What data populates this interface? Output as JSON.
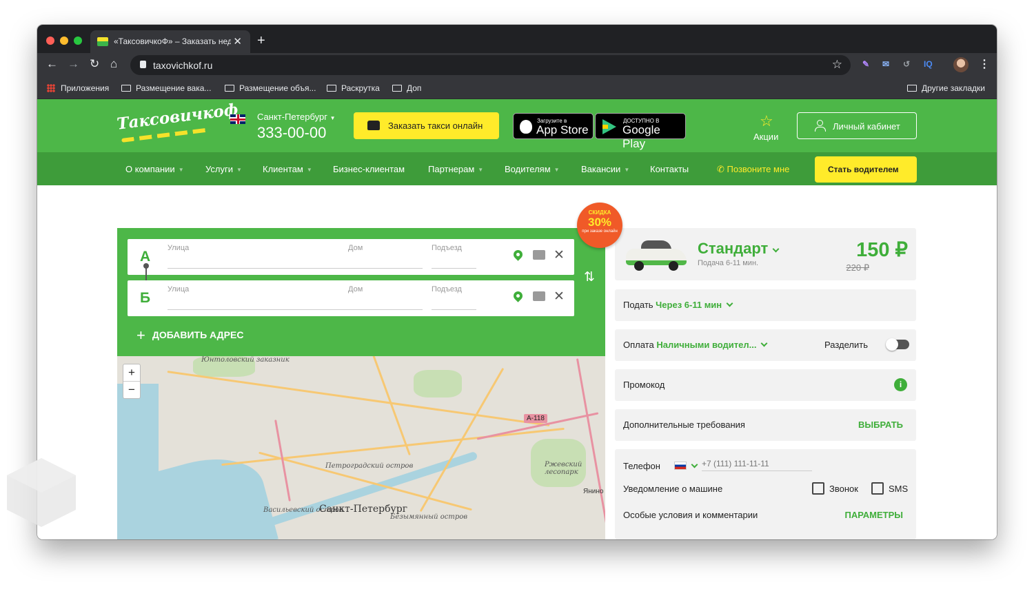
{
  "browser": {
    "tab_title": "«ТаксовичкоФ» – Заказать нед",
    "url": "taxovichkof.ru",
    "bookmarks": [
      "Приложения",
      "Размещение вака...",
      "Размещение объя...",
      "Раскрутка",
      "Доп"
    ],
    "other_bookmarks": "Другие закладки",
    "ext_iq": "IQ"
  },
  "header": {
    "logo_text": "Таксовичкоф",
    "city": "Санкт-Петербург",
    "phone": "333-00-00",
    "order_button": "Заказать такси онлайн",
    "app_store_small": "Загрузите в",
    "app_store_big": "App Store",
    "google_play_small": "ДОСТУПНО В",
    "google_play_big": "Google Play",
    "promos": "Акции",
    "cabinet": "Личный кабинет"
  },
  "nav": {
    "items": [
      "О компании",
      "Услуги",
      "Клиентам",
      "Бизнес-клиентам",
      "Партнерам",
      "Водителям",
      "Вакансии",
      "Контакты"
    ],
    "call_me": "Позвоните мне",
    "become_driver": "Стать водителем"
  },
  "discount": {
    "top": "СКИДКА",
    "value": "30%",
    "bottom": "при заказе онлайн"
  },
  "order_form": {
    "point_a": "А",
    "point_b": "Б",
    "street_label": "Улица",
    "house_label": "Дом",
    "entrance_label": "Подъезд",
    "add_address": "ДОБАВИТЬ АДРЕС"
  },
  "map": {
    "labels": [
      "Юнтоловский заказник",
      "Петроградский остров",
      "Васильевский остров",
      "Безымянный остров",
      "Ржевский лесопарк"
    ],
    "city_label": "Санкт-Петербург",
    "road_shield": "А-118",
    "janino": "Янино"
  },
  "tariff": {
    "name": "Стандарт",
    "sub": "Подача 6-11 мин.",
    "price": "150 ₽",
    "old_price": "220 ₽"
  },
  "options": {
    "pickup_label": "Подать",
    "pickup_value": "Через 6-11 мин",
    "payment_label": "Оплата",
    "payment_value": "Наличными водител...",
    "split_label": "Разделить",
    "promo_label": "Промокод",
    "extra_label": "Дополнительные требования",
    "extra_action": "ВЫБРАТЬ",
    "phone_label": "Телефон",
    "phone_placeholder": "+7 (111) 111-11-11",
    "notify_label": "Уведомление о машине",
    "call_option": "Звонок",
    "sms_option": "SMS",
    "special_label": "Особые условия и комментарии",
    "special_action": "ПАРАМЕТРЫ"
  },
  "colors": {
    "brand_green": "#4db748",
    "nav_green": "#3e9c3a",
    "accent_yellow": "#ffeb2a",
    "discount_orange": "#f05a28"
  }
}
